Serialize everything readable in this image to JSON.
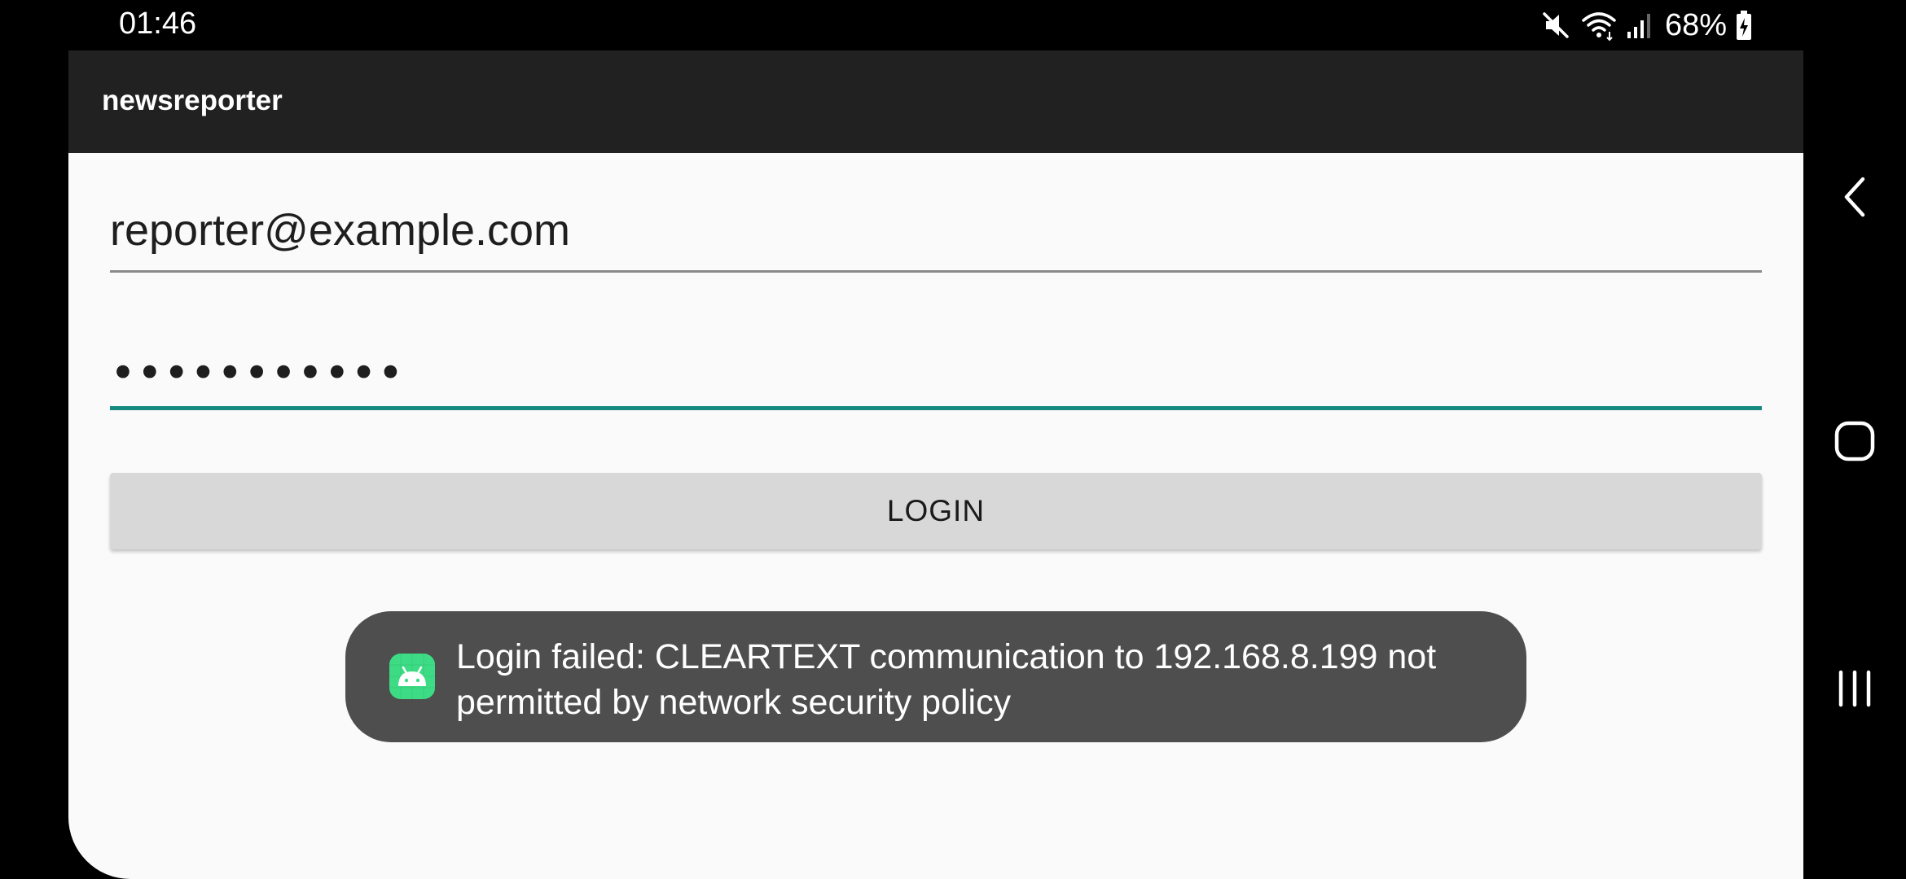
{
  "status_bar": {
    "time": "01:46",
    "battery": "68%",
    "icons": [
      "mute-icon",
      "wifi-icon",
      "signal-icon",
      "battery-charging-icon"
    ]
  },
  "app": {
    "title": "newsreporter"
  },
  "login_form": {
    "email_value": "reporter@example.com",
    "password_value": "•••••••••••",
    "login_label": "LOGIN"
  },
  "toast": {
    "icon": "android-icon",
    "message": "Login failed: CLEARTEXT communication to 192.168.8.199 not permitted by network security policy"
  },
  "nav_bar": {
    "buttons": [
      "back-icon",
      "home-icon",
      "recents-icon"
    ]
  },
  "colors": {
    "app_bar": "#212121",
    "accent": "#168a80",
    "button": "#d7d8d7",
    "toast": "#4e4e4e",
    "android_green": "#3ddc84"
  }
}
